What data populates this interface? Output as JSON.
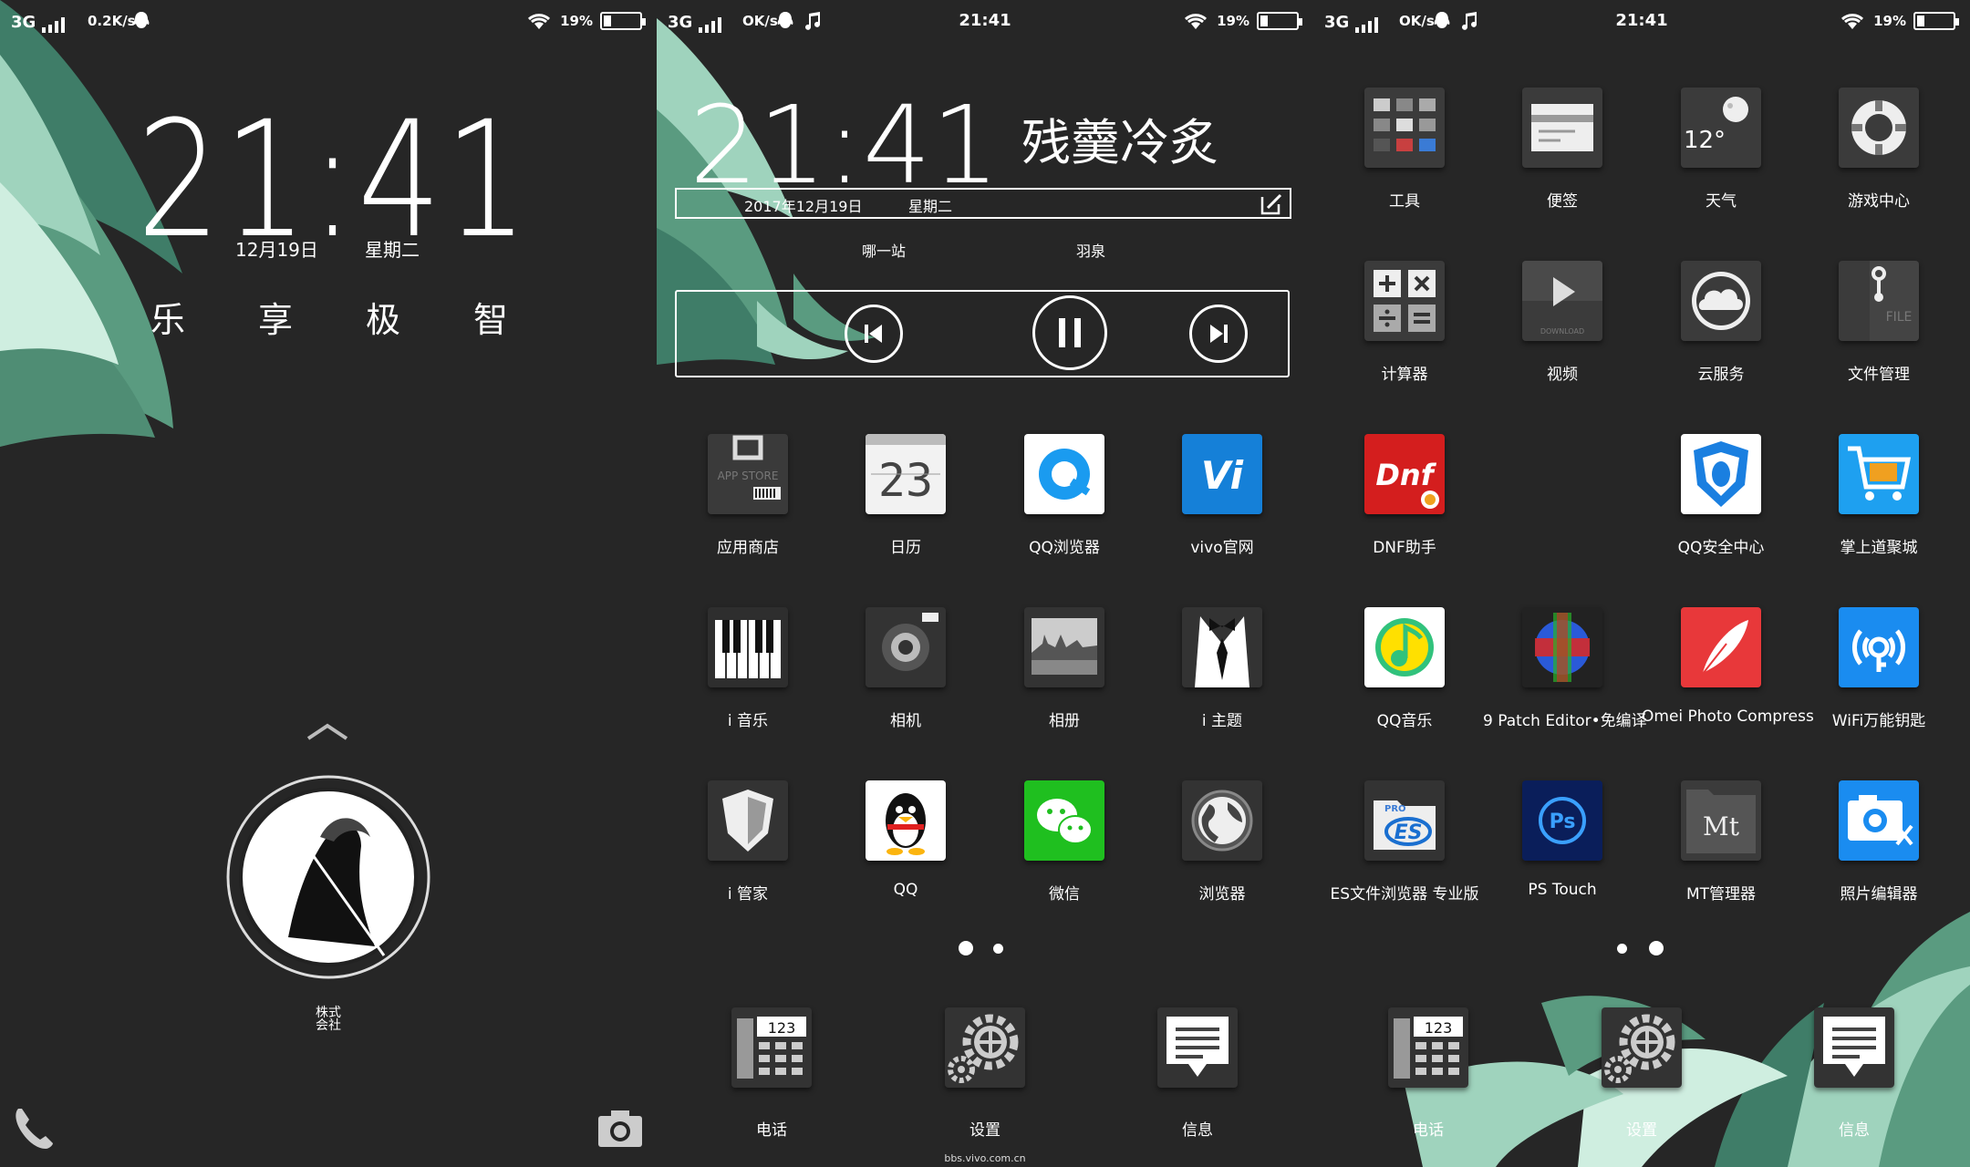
{
  "colors": {
    "background": "#262626",
    "leaf": "#5fa58a",
    "accent_white": "#ffffff"
  },
  "lock_screen": {
    "status": {
      "network": "3G",
      "speed": "0.2K/s",
      "battery": "19%",
      "battery_level": 0.19
    },
    "time": "21:41",
    "date": "12月19日",
    "weekday": "星期二",
    "motto": [
      "乐",
      "享",
      "极",
      "智"
    ],
    "circle_label_line1": "株式",
    "circle_label_line2": "会社",
    "phone_icon": "phone-icon",
    "camera_icon": "camera-icon"
  },
  "home1": {
    "status": {
      "network": "3G",
      "speed": "OK/s",
      "clock": "21:41",
      "battery": "19%",
      "battery_level": 0.19
    },
    "widget": {
      "time": "21:41",
      "name": "残羹冷炙",
      "date": "2017年12月19日",
      "weekday": "星期二",
      "song_title": "哪一站",
      "song_artist": "羽泉"
    },
    "apps": [
      {
        "label": "应用商店",
        "icon": "app-store-icon"
      },
      {
        "label": "日历",
        "icon": "calendar-icon",
        "badge": "23"
      },
      {
        "label": "QQ浏览器",
        "icon": "qq-browser-icon"
      },
      {
        "label": "vivo官网",
        "icon": "vivo-icon",
        "badge": "Vi"
      },
      {
        "label": "i 音乐",
        "icon": "piano-icon"
      },
      {
        "label": "相机",
        "icon": "camera-icon"
      },
      {
        "label": "相册",
        "icon": "gallery-icon"
      },
      {
        "label": "i 主题",
        "icon": "theme-icon"
      },
      {
        "label": "i 管家",
        "icon": "shield-icon"
      },
      {
        "label": "QQ",
        "icon": "qq-penguin-icon"
      },
      {
        "label": "微信",
        "icon": "wechat-icon"
      },
      {
        "label": "浏览器",
        "icon": "globe-icon"
      }
    ],
    "dock": [
      {
        "label": "电话",
        "icon": "desk-phone-icon",
        "badge": "123"
      },
      {
        "label": "设置",
        "icon": "settings-gear-icon"
      },
      {
        "label": "信息",
        "icon": "message-icon"
      }
    ],
    "watermark": "bbs.vivo.com.cn"
  },
  "home2": {
    "status": {
      "network": "3G",
      "speed": "OK/s",
      "clock": "21:41",
      "battery": "19%",
      "battery_level": 0.19
    },
    "apps": [
      {
        "label": "工具",
        "icon": "tools-folder-icon"
      },
      {
        "label": "便签",
        "icon": "note-icon"
      },
      {
        "label": "天气",
        "icon": "weather-icon",
        "badge": "12°"
      },
      {
        "label": "游戏中心",
        "icon": "lifebuoy-icon"
      },
      {
        "label": "计算器",
        "icon": "calculator-icon"
      },
      {
        "label": "视频",
        "icon": "video-play-icon",
        "badge": "DOWNLOAD"
      },
      {
        "label": "云服务",
        "icon": "cloud-icon"
      },
      {
        "label": "文件管理",
        "icon": "file-manager-icon",
        "badge": "FILE"
      },
      {
        "label": "DNF助手",
        "icon": "dnf-icon",
        "badge": "Dnf"
      },
      {
        "label": "",
        "icon": ""
      },
      {
        "label": "QQ安全中心",
        "icon": "qq-security-icon"
      },
      {
        "label": "掌上道聚城",
        "icon": "shopping-cart-icon"
      },
      {
        "label": "QQ音乐",
        "icon": "qq-music-icon"
      },
      {
        "label": "9 Patch Editor•免编译",
        "icon": "nine-patch-icon"
      },
      {
        "label": "Omei Photo Compress",
        "icon": "feather-icon"
      },
      {
        "label": "WiFi万能钥匙",
        "icon": "wifi-key-icon"
      },
      {
        "label": "ES文件浏览器 专业版",
        "icon": "es-explorer-icon",
        "badge": "ES"
      },
      {
        "label": "PS Touch",
        "icon": "ps-touch-icon",
        "badge": "Ps"
      },
      {
        "label": "MT管理器",
        "icon": "mt-manager-icon",
        "badge": "Mt"
      },
      {
        "label": "照片编辑器",
        "icon": "photo-editor-icon"
      }
    ],
    "dock": [
      {
        "label": "电话",
        "icon": "desk-phone-icon",
        "badge": "123"
      },
      {
        "label": "设置",
        "icon": "settings-gear-icon"
      },
      {
        "label": "信息",
        "icon": "message-icon"
      }
    ]
  }
}
